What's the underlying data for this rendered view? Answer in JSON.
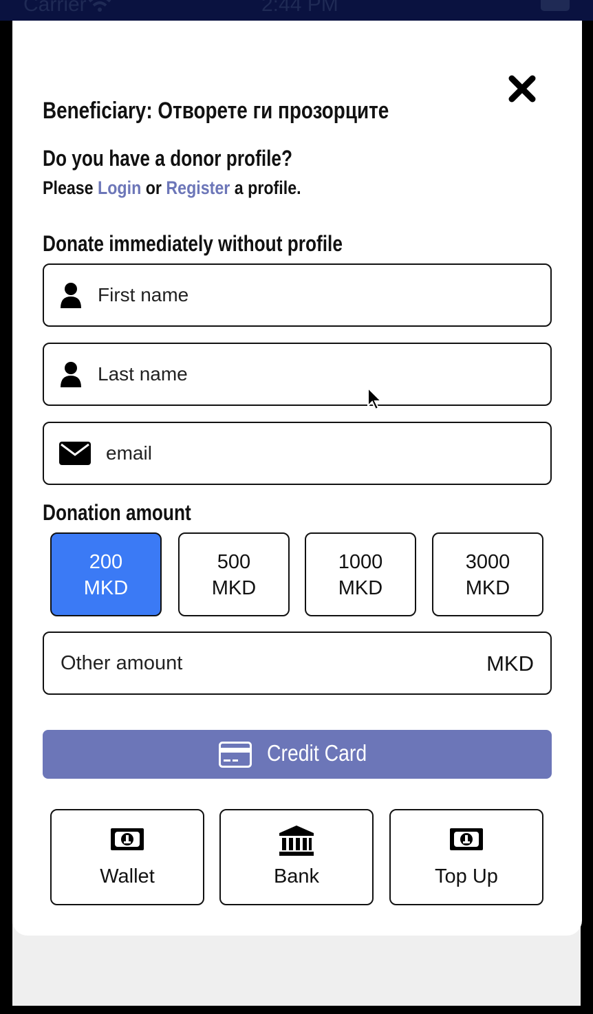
{
  "status_bar": {
    "carrier": "Carrier",
    "time": "2:44 PM"
  },
  "modal": {
    "title": "Beneficiary: Отворете ги прозорците",
    "donor_question": "Do you have a donor profile?",
    "login_prefix": "Please",
    "login_link": "Login",
    "login_or": "or",
    "register_link": "Register",
    "login_suffix": "a profile.",
    "donate_heading": "Donate immediately without profile",
    "fields": {
      "first_name_placeholder": "First name",
      "last_name_placeholder": "Last name",
      "email_placeholder": "email"
    },
    "amount_heading": "Donation amount",
    "amounts": [
      {
        "value": "200",
        "currency": "MKD",
        "selected": true
      },
      {
        "value": "500",
        "currency": "MKD",
        "selected": false
      },
      {
        "value": "1000",
        "currency": "MKD",
        "selected": false
      },
      {
        "value": "3000",
        "currency": "MKD",
        "selected": false
      }
    ],
    "other_amount_placeholder": "Other amount",
    "other_amount_unit": "MKD",
    "credit_card_label": "Credit Card",
    "payment_options": [
      {
        "label": "Wallet",
        "icon": "money-bill-icon"
      },
      {
        "label": "Bank",
        "icon": "bank-icon"
      },
      {
        "label": "Top Up",
        "icon": "money-bill-icon"
      }
    ]
  },
  "colors": {
    "accent": "#6c76b8",
    "selected_amount": "#3b7af5",
    "status_bar": "#0a1240"
  }
}
